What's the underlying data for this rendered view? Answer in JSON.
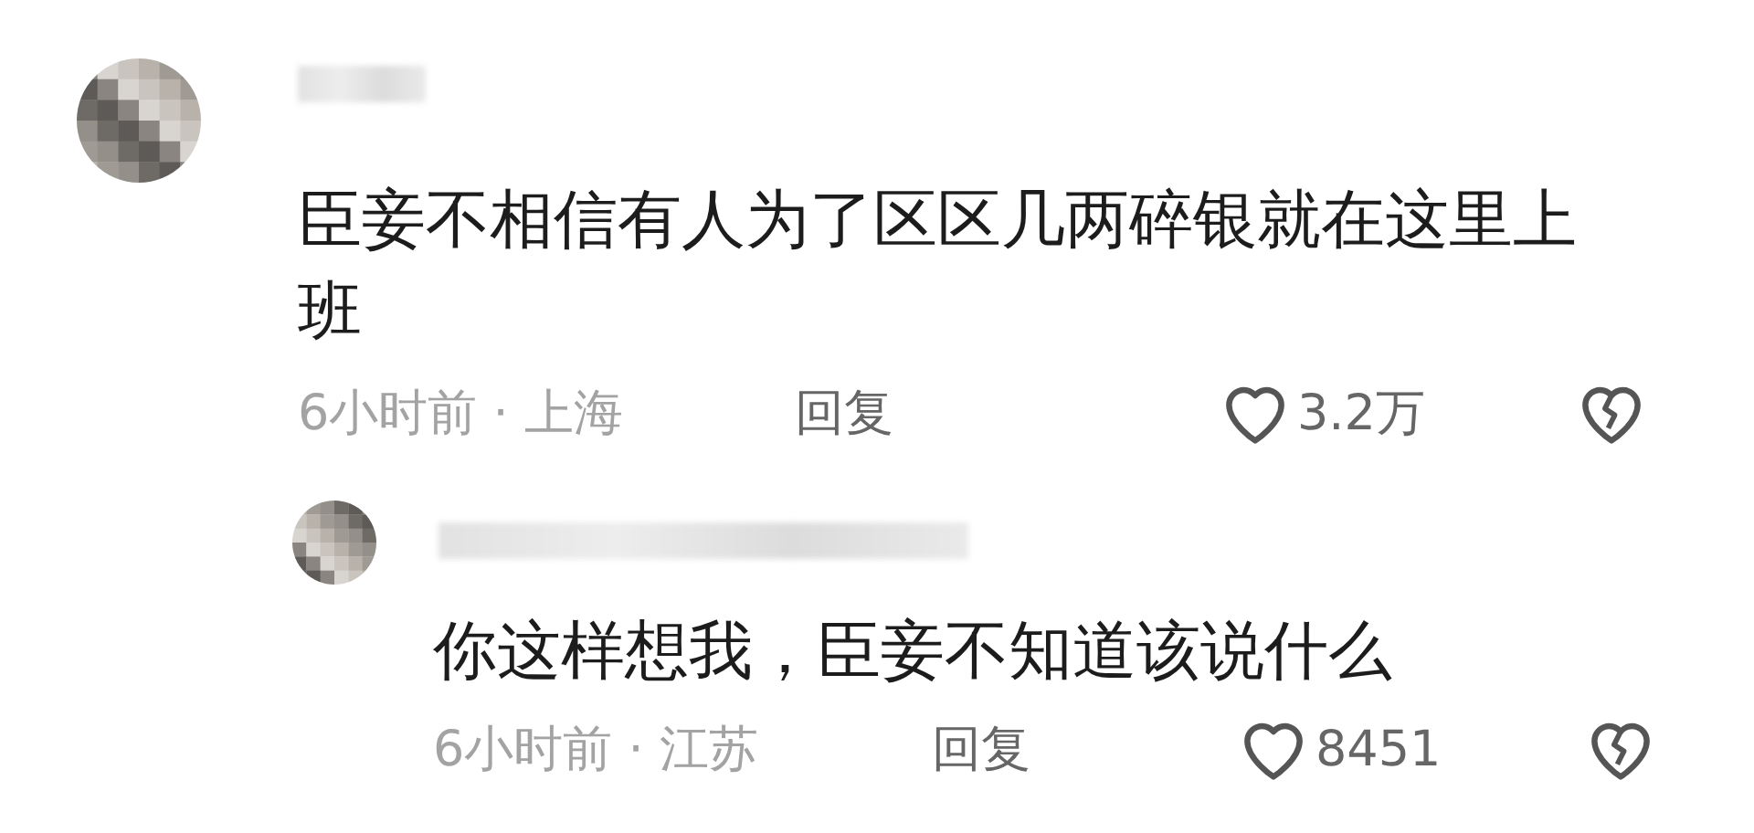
{
  "comments": [
    {
      "text": "臣妾不相信有人为了区区几两碎银就在这里上班",
      "meta": "6小时前 · 上海",
      "reply_label": "回复",
      "likes": "3.2万",
      "children": [
        {
          "text": "你这样想我，臣妾不知道该说什么",
          "meta": "6小时前 · 江苏",
          "reply_label": "回复",
          "likes": "8451"
        }
      ]
    }
  ]
}
